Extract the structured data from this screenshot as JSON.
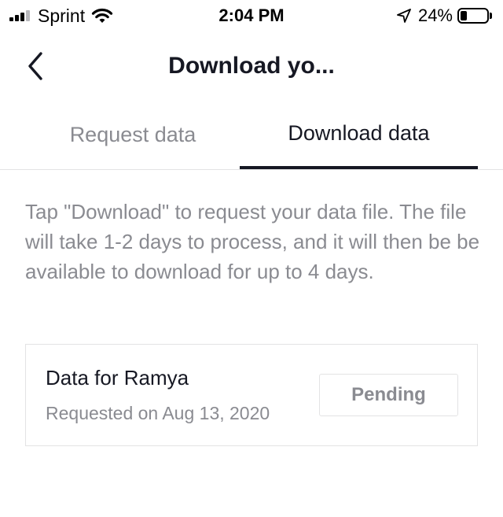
{
  "status_bar": {
    "carrier": "Sprint",
    "time": "2:04 PM",
    "battery_percent": "24%",
    "battery_level": 0.24,
    "signal_bars_filled": 3,
    "signal_bars_total": 4,
    "icons": [
      "signal-icon",
      "wifi-icon",
      "location-arrow-icon",
      "battery-icon"
    ]
  },
  "header": {
    "back_icon": "chevron-left-icon",
    "title": "Download yo..."
  },
  "tabs": [
    {
      "label": "Request data",
      "active": false
    },
    {
      "label": "Download data",
      "active": true
    }
  ],
  "description": "Tap \"Download\" to request your data file. The file will take 1-2 days to process, and it will then be be available to download for up to 4 days.",
  "data_card": {
    "title": "Data for Ramya",
    "subtitle": "Requested on Aug 13, 2020",
    "status_button_label": "Pending"
  },
  "colors": {
    "primary_text": "#161823",
    "secondary_text": "#8a8b91",
    "border": "#e3e3e4",
    "background": "#ffffff"
  }
}
